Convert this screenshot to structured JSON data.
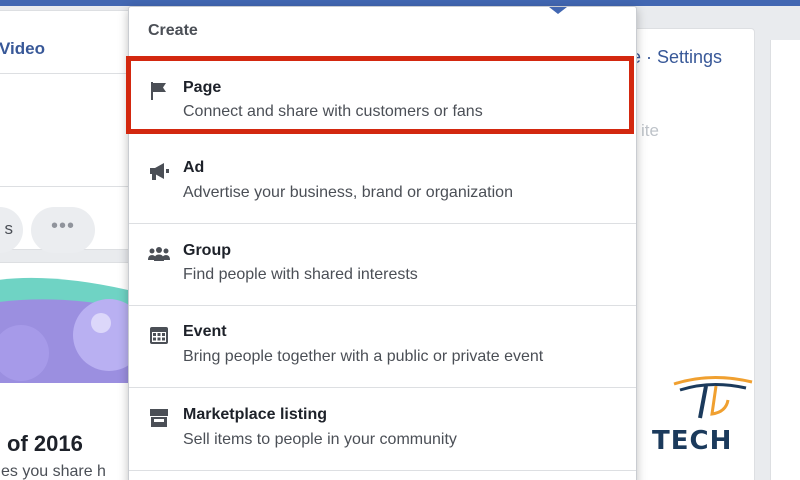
{
  "background": {
    "left_tab_label": "Video",
    "left_pill_label": "s",
    "left_more": "•••",
    "memory_title": "of 2016",
    "memory_subtitle": "es you share h",
    "right_links": "e · Settings",
    "right_faint": "ite"
  },
  "menu": {
    "header": "Create",
    "items": [
      {
        "icon": "flag-icon",
        "title": "Page",
        "description": "Connect and share with customers or fans"
      },
      {
        "icon": "megaphone-icon",
        "title": "Ad",
        "description": "Advertise your business, brand or organization"
      },
      {
        "icon": "group-icon",
        "title": "Group",
        "description": "Find people with shared interests"
      },
      {
        "icon": "calendar-icon",
        "title": "Event",
        "description": "Bring people together with a public or private event"
      },
      {
        "icon": "storefront-icon",
        "title": "Marketplace listing",
        "description": "Sell items to people in your community"
      }
    ]
  },
  "watermark": {
    "brand": "TECH"
  },
  "colors": {
    "accent": "#4267b2",
    "highlight": "#d3280f",
    "link": "#385898",
    "brand": "#1b3a5c",
    "brand_accent": "#f0a030"
  }
}
